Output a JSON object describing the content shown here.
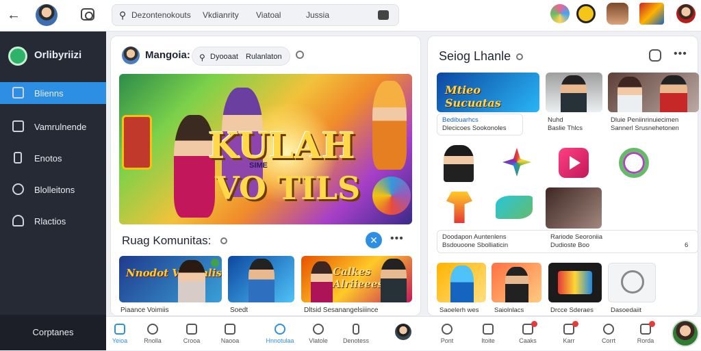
{
  "topbar": {
    "search_terms": [
      "Dezontenokouts",
      "Vkdianrity",
      "Viatoal",
      "Jussia"
    ]
  },
  "sidebar": {
    "brand": "Orlibyriizi",
    "items": [
      {
        "label": "Blienns",
        "icon": "home-icon",
        "active": true
      },
      {
        "label": "Vamrulnende",
        "icon": "inbox-icon",
        "active": false
      },
      {
        "label": "Enotos",
        "icon": "bookmark-icon",
        "active": false
      },
      {
        "label": "Blolleitons",
        "icon": "settings-icon",
        "active": false
      },
      {
        "label": "Rlactios",
        "icon": "user-icon",
        "active": false
      }
    ],
    "footer": "Corptanes"
  },
  "main": {
    "title": "Mangoia:",
    "search": [
      "Dyooaat",
      "Rulanlaton"
    ],
    "hero": {
      "line1": "KULAH",
      "line2": "VO TILS",
      "tag": "SIME"
    },
    "section_title": "Ruag Komunitas:",
    "cards": [
      {
        "caption": "Piaance Voimiis",
        "overlay": "Nnodot Voiumlis"
      },
      {
        "caption": "Soedt"
      },
      {
        "caption": "Dltsid Sesanangelsiiince",
        "overlay": "Calkes Alriieees"
      }
    ]
  },
  "right": {
    "title": "Seiog Lhanle",
    "top_cards": [
      {
        "overlay": "Mtieo Sucuatas",
        "caption1": "Bedibuarhcs",
        "caption2": "Dlecicoes Sookonoles"
      },
      {
        "caption1": "Nuhd",
        "caption2": "Baslie Thlcs"
      },
      {
        "caption1": "Dluie Peniinrinuiecimen",
        "caption2": "Sannerl Srusnehetonen"
      }
    ],
    "mid_cards": [
      {
        "caption1": "Doodapon Auntenlens",
        "caption2": "Bsdouoone Sbolliaticin"
      },
      {
        "caption1": "Rariode Seoroniia",
        "caption2": "Dudioste Boo",
        "count": "6"
      }
    ],
    "bottom_cards": [
      {
        "caption": "Saoelerh wes"
      },
      {
        "caption": "Saiolnlacs"
      },
      {
        "caption": "Drcce Sderaes"
      },
      {
        "caption": "Dasoedaiit"
      }
    ]
  },
  "bottom_nav": [
    {
      "label": "Yeioa",
      "active": true
    },
    {
      "label": "Rnolla",
      "active": false
    },
    {
      "label": "Crooa",
      "active": false
    },
    {
      "label": "Naooa",
      "active": false
    },
    {
      "label": "Hnnotulaa",
      "active": true
    },
    {
      "label": "Vlatole",
      "active": false
    },
    {
      "label": "Denotess",
      "active": false
    },
    {
      "label": "Pont",
      "active": false
    },
    {
      "label": "Itoite",
      "active": false
    },
    {
      "label": "Caaks",
      "active": false
    },
    {
      "label": "Karr",
      "active": false
    },
    {
      "label": "Corrt",
      "active": false
    },
    {
      "label": "Rorda",
      "active": false
    }
  ],
  "colors": {
    "accent": "#2d8fe4",
    "sidebar": "#262a35",
    "badge": "#e23c3c"
  }
}
